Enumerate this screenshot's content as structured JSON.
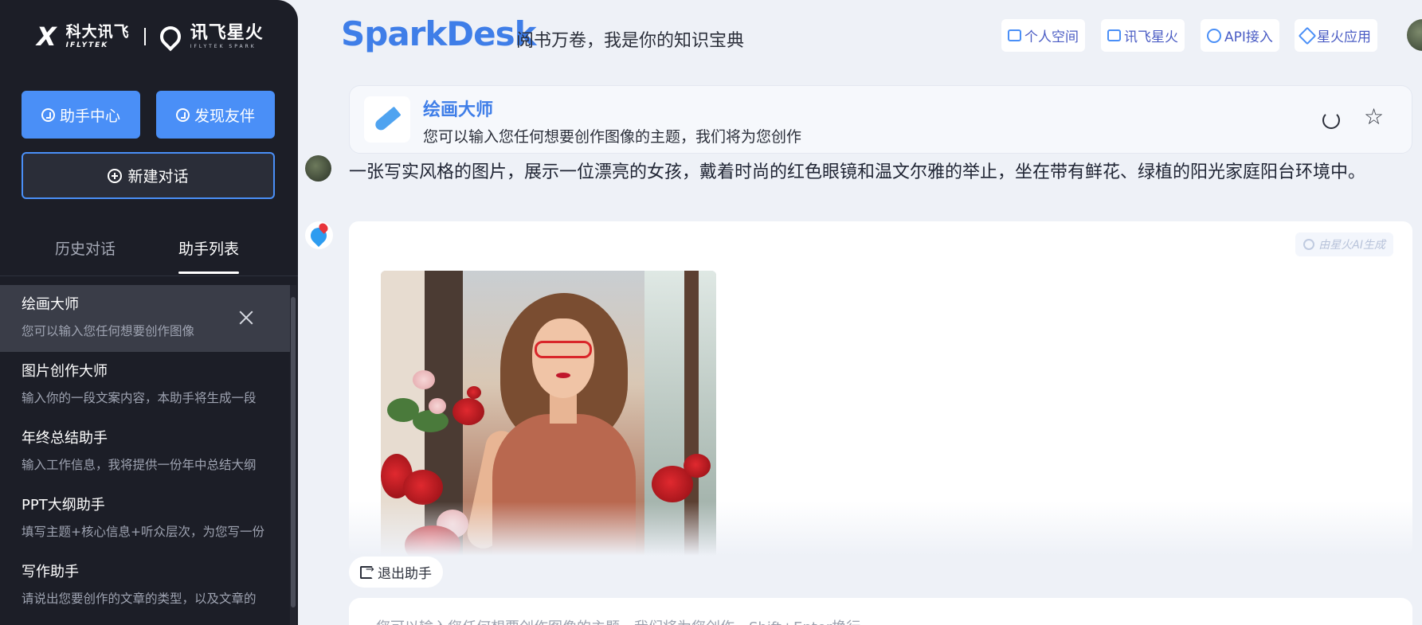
{
  "sidebar": {
    "logo": {
      "brand_cn": "科大讯飞",
      "brand_en": "IFLYTEK",
      "spark_cn": "讯飞星火",
      "spark_en": "IFLYTEK SPARK"
    },
    "assistant_center_label": "助手中心",
    "discover_friends_label": "发现友伴",
    "new_chat_label": "新建对话",
    "tabs": [
      {
        "label": "历史对话",
        "active": false
      },
      {
        "label": "助手列表",
        "active": true
      }
    ],
    "items": [
      {
        "title": "绘画大师",
        "desc": "您可以输入您任何想要创作图像",
        "active": true
      },
      {
        "title": "图片创作大师",
        "desc": "输入你的一段文案内容，本助手将生成一段",
        "active": false
      },
      {
        "title": "年终总结助手",
        "desc": "输入工作信息，我将提供一份年中总结大纲",
        "active": false
      },
      {
        "title": "PPT大纲助手",
        "desc": "填写主题+核心信息+听众层次，为您写一份",
        "active": false
      },
      {
        "title": "写作助手",
        "desc": "请说出您要创作的文章的类型，以及文章的",
        "active": false
      }
    ]
  },
  "header": {
    "brand": "SparkDesk",
    "slogan": "阅书万卷，我是你的知识宝典",
    "nav": [
      {
        "label": "个人空间",
        "icon": "folder-icon"
      },
      {
        "label": "讯飞星火",
        "icon": "laptop-icon"
      },
      {
        "label": "API接入",
        "icon": "api-icon"
      },
      {
        "label": "星火应用",
        "icon": "cube-icon"
      }
    ]
  },
  "assistant": {
    "name": "绘画大师",
    "description": "您可以输入您任何想要创作图像的主题，我们将为您创作"
  },
  "chat": {
    "user_message": "一张写实风格的图片，展示一位漂亮的女孩，戴着时尚的红色眼镜和温文尔雅的举止，坐在带有鲜花、绿植的阳光家庭阳台环境中。",
    "ai_badge": "由星火AI生成"
  },
  "exit_label": "退出助手",
  "input": {
    "placeholder": "您可以输入您任何想要创作图像的主题，我们将为您创作，Shift+Enter换行"
  },
  "colors": {
    "accent": "#4a8ff7",
    "brand": "#3f7ee8",
    "sidebar_bg": "#1c1e27"
  }
}
